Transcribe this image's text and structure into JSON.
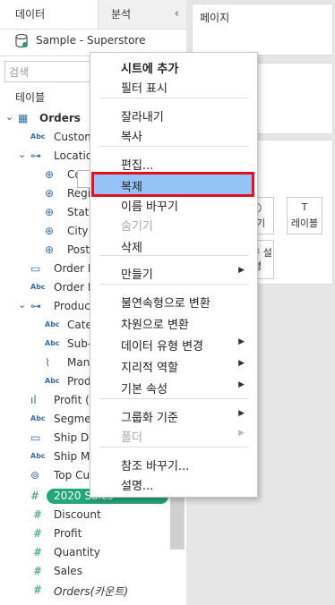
{
  "tabs": {
    "data": "데이터",
    "analysis": "분석"
  },
  "datasource": "Sample - Superstore",
  "search": {
    "placeholder": "검색"
  },
  "tables_header": "테이블",
  "fields": [
    {
      "label": "Orders",
      "icon": "table-icon"
    },
    {
      "label": "Customer Name",
      "icon": "abc-icon"
    },
    {
      "label": "Location",
      "icon": "hierarchy-icon"
    },
    {
      "label": "Country/Region",
      "icon": "globe-icon"
    },
    {
      "label": "Region",
      "icon": "globe-icon"
    },
    {
      "label": "State/Province",
      "icon": "globe-icon"
    },
    {
      "label": "City",
      "icon": "globe-icon"
    },
    {
      "label": "Postal Code",
      "icon": "globe-icon"
    },
    {
      "label": "Order Date",
      "icon": "calendar-icon"
    },
    {
      "label": "Order ID",
      "icon": "abc-icon"
    },
    {
      "label": "Product",
      "icon": "hierarchy-icon"
    },
    {
      "label": "Category",
      "icon": "abc-icon"
    },
    {
      "label": "Sub-Category",
      "icon": "abc-icon"
    },
    {
      "label": "Manufacturer",
      "icon": "paperclip-icon"
    },
    {
      "label": "Product Name",
      "icon": "abc-icon"
    },
    {
      "label": "Profit (bin)",
      "icon": "bins-icon"
    },
    {
      "label": "Segment",
      "icon": "abc-icon"
    },
    {
      "label": "Ship Date",
      "icon": "calendar-icon"
    },
    {
      "label": "Ship Mode",
      "icon": "abc-icon"
    },
    {
      "label": "Top Customers",
      "icon": "set-icon"
    },
    {
      "label": "2020 Sales",
      "icon": "hash-icon"
    },
    {
      "label": "Discount",
      "icon": "hash-icon"
    },
    {
      "label": "Profit",
      "icon": "hash-icon"
    },
    {
      "label": "Quantity",
      "icon": "hash-icon"
    },
    {
      "label": "Sales",
      "icon": "hash-icon"
    },
    {
      "label": "Orders(카운트)",
      "icon": "hash-icon"
    }
  ],
  "right": {
    "pages_title": "페이지",
    "marks_buttons": [
      {
        "label": "크기",
        "icon": "size-icon"
      },
      {
        "label": "레이블",
        "icon": "text-icon"
      }
    ],
    "tooltip_label": "도구 설명"
  },
  "menu": {
    "items": [
      {
        "label": "시트에 추가"
      },
      {
        "label": "필터 표시"
      },
      {
        "label": "잘라내기"
      },
      {
        "label": "복사"
      },
      {
        "label": "편집..."
      },
      {
        "label": "복제"
      },
      {
        "label": "이름 바꾸기"
      },
      {
        "label": "숨기기"
      },
      {
        "label": "삭제"
      },
      {
        "label": "만들기"
      },
      {
        "label": "불연속형으로 변환"
      },
      {
        "label": "차원으로 변환"
      },
      {
        "label": "데이터 유형 변경"
      },
      {
        "label": "지리적 역할"
      },
      {
        "label": "기본 속성"
      },
      {
        "label": "그룹화 기준"
      },
      {
        "label": "폴더"
      },
      {
        "label": "참조 바꾸기..."
      },
      {
        "label": "설명..."
      }
    ]
  },
  "colors": {
    "pill": "#24a67a",
    "selection": "#96c3f5",
    "highlight_border": "#e5101f"
  }
}
